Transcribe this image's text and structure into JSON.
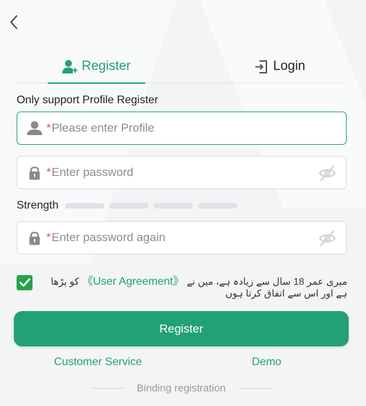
{
  "tabs": {
    "register": "Register",
    "login": "Login"
  },
  "support_note": "Only support Profile Register",
  "fields": {
    "profile": {
      "required_mark": "*",
      "placeholder": "Please enter Profile"
    },
    "password": {
      "required_mark": "*",
      "placeholder": "Enter password"
    },
    "password_again": {
      "required_mark": "*",
      "placeholder": "Enter password again"
    }
  },
  "strength": {
    "label": "Strength",
    "level": 0
  },
  "agreement": {
    "checked": true,
    "before_link": "میری عمر 18 سال سے زیادہ ہے، میں نے",
    "link_text": "《User Agreement》",
    "after_link": "کو پڑھا ہے اور اس سے اتفاق کرتا ہوں"
  },
  "register_button": "Register",
  "links": {
    "customer_service": "Customer Service",
    "demo": "Demo"
  },
  "binding_label": "Binding registration",
  "colors": {
    "accent": "#23a077",
    "required": "#e0524f",
    "checkbox": "#25a34a"
  },
  "icons": {
    "back": "chevron-left-icon",
    "register_tab": "user-plus-icon",
    "login_tab": "login-door-icon",
    "profile": "user-icon",
    "password": "lock-icon",
    "eye_off": "eye-off-icon",
    "check": "check-icon"
  }
}
